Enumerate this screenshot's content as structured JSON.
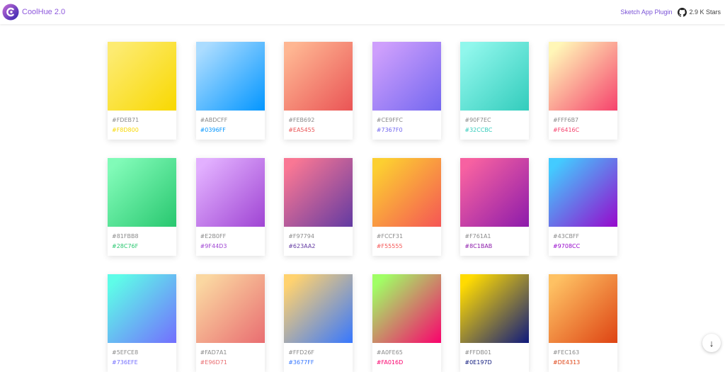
{
  "header": {
    "brand": "CoolHue 2.0",
    "plugin_link": "Sketch App Plugin",
    "stars": "2.9 K Stars"
  },
  "colors": {
    "brand": "#8e58dc"
  },
  "gradients": [
    {
      "start": "#FDEB71",
      "end": "#F8D800"
    },
    {
      "start": "#ABDCFF",
      "end": "#0396FF"
    },
    {
      "start": "#FEB692",
      "end": "#EA5455"
    },
    {
      "start": "#CE9FFC",
      "end": "#7367F0"
    },
    {
      "start": "#90F7EC",
      "end": "#32CCBC"
    },
    {
      "start": "#FFF6B7",
      "end": "#F6416C"
    },
    {
      "start": "#81FBB8",
      "end": "#28C76F"
    },
    {
      "start": "#E2B0FF",
      "end": "#9F44D3"
    },
    {
      "start": "#F97794",
      "end": "#623AA2"
    },
    {
      "start": "#FCCF31",
      "end": "#F55555"
    },
    {
      "start": "#F761A1",
      "end": "#8C1BAB"
    },
    {
      "start": "#43CBFF",
      "end": "#9708CC"
    },
    {
      "start": "#5EFCE8",
      "end": "#736EFE"
    },
    {
      "start": "#FAD7A1",
      "end": "#E96D71"
    },
    {
      "start": "#FFD26F",
      "end": "#3677FF"
    },
    {
      "start": "#A0FE65",
      "end": "#FA016D"
    },
    {
      "start": "#FFDB01",
      "end": "#0E197D"
    },
    {
      "start": "#FEC163",
      "end": "#DE4313"
    }
  ],
  "scroll_icon": "arrow-down-icon"
}
